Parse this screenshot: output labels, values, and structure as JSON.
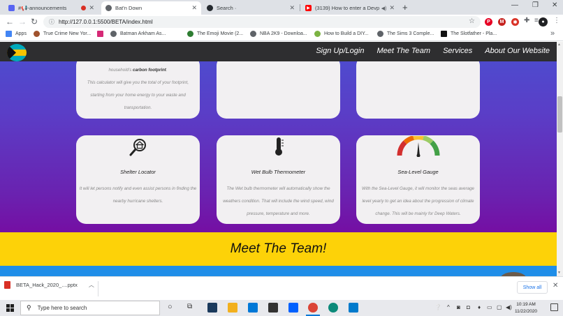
{
  "browser": {
    "tabs": [
      {
        "title": "#📢-announcements",
        "active": false
      },
      {
        "title": "Bat'n Down",
        "active": true
      },
      {
        "title": "Search ·",
        "active": false
      },
      {
        "title": "(3139) How to enter a Devp",
        "active": false
      }
    ],
    "url": "http://127.0.0.1:5500/BETA/index.html",
    "bookmarks": [
      {
        "label": "Apps"
      },
      {
        "label": "True Crime New Yor..."
      },
      {
        "label": ""
      },
      {
        "label": "Batman Arkham As..."
      },
      {
        "label": "The Emoji Movie (2..."
      },
      {
        "label": "NBA 2K9 - Downloa..."
      },
      {
        "label": "How to Build a DIY..."
      },
      {
        "label": "The Sims 3 Comple..."
      },
      {
        "label": "The Slotfather - Pla..."
      }
    ]
  },
  "site": {
    "nav": [
      "Sign Up/Login",
      "Meet The Team",
      "Services",
      "About Our Website"
    ],
    "top_cards": {
      "first_line_prefix": "household's ",
      "first_line_bold": "carbon footprint",
      "first_line_suffix": ".",
      "desc_rest": "This calculator will give you the total of your footprint, starting from your home energy to your waste and transportation."
    },
    "cards": [
      {
        "title": "Shelter Locator",
        "desc": "It will let persons notify and even assist persons in finding the nearby hurricane shelters."
      },
      {
        "title": "Wet Bulb Thermometer",
        "desc": "The Wet bulb thermometer will automatically show the weathers condition. That will include the wind speed, wind pressure, temperature and more."
      },
      {
        "title": "Sea-Level Gauge",
        "desc": "With the Sea-Level Gauge, it will monitor the seas average level yearly to get an idea about the progression of climate change. This will be mainly for Deep Waters."
      }
    ],
    "team_heading": "Meet The Team!"
  },
  "download_bar": {
    "file": "BETA_Hack_2020_....pptx",
    "show_all": "Show all"
  },
  "taskbar": {
    "search_placeholder": "Type here to search",
    "time": "10:19 AM",
    "date": "11/22/2020"
  }
}
